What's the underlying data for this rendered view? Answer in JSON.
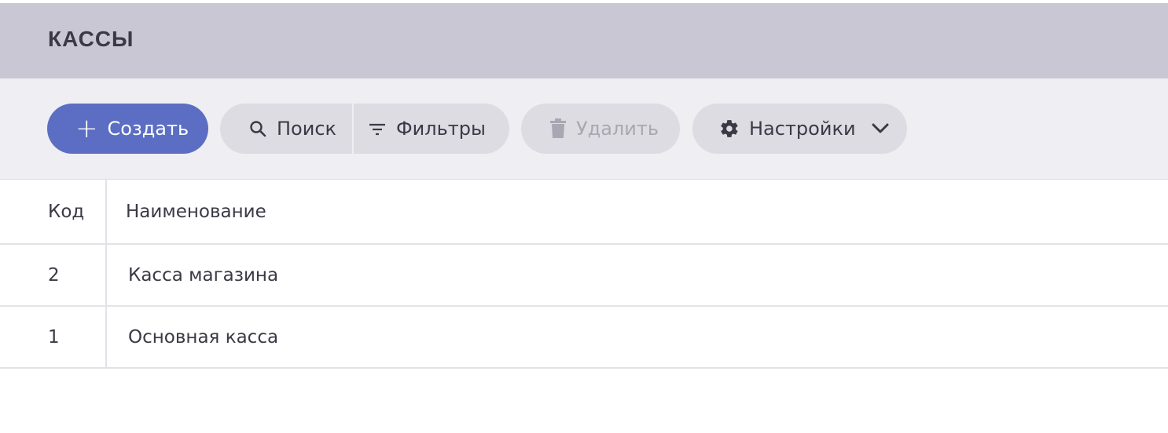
{
  "header": {
    "title": "КАССЫ"
  },
  "toolbar": {
    "create_label": "Создать",
    "search_label": "Поиск",
    "filters_label": "Фильтры",
    "delete_label": "Удалить",
    "settings_label": "Настройки"
  },
  "table": {
    "columns": [
      "Код",
      "Наименование"
    ],
    "rows": [
      {
        "code": "2",
        "name": "Касса магазина"
      },
      {
        "code": "1",
        "name": "Основная касса"
      }
    ]
  },
  "colors": {
    "header_bg": "#c9c7d3",
    "toolbar_bg": "#efeef2",
    "accent": "#5b6ec3",
    "button_bg": "#dddce3",
    "disabled_text": "#a9a8b2"
  },
  "icons": {
    "create": "plus-icon",
    "search": "search-icon",
    "filters": "filter-icon",
    "delete": "trash-icon",
    "settings": "gear-icon",
    "settings_menu": "chevron-down-icon"
  }
}
